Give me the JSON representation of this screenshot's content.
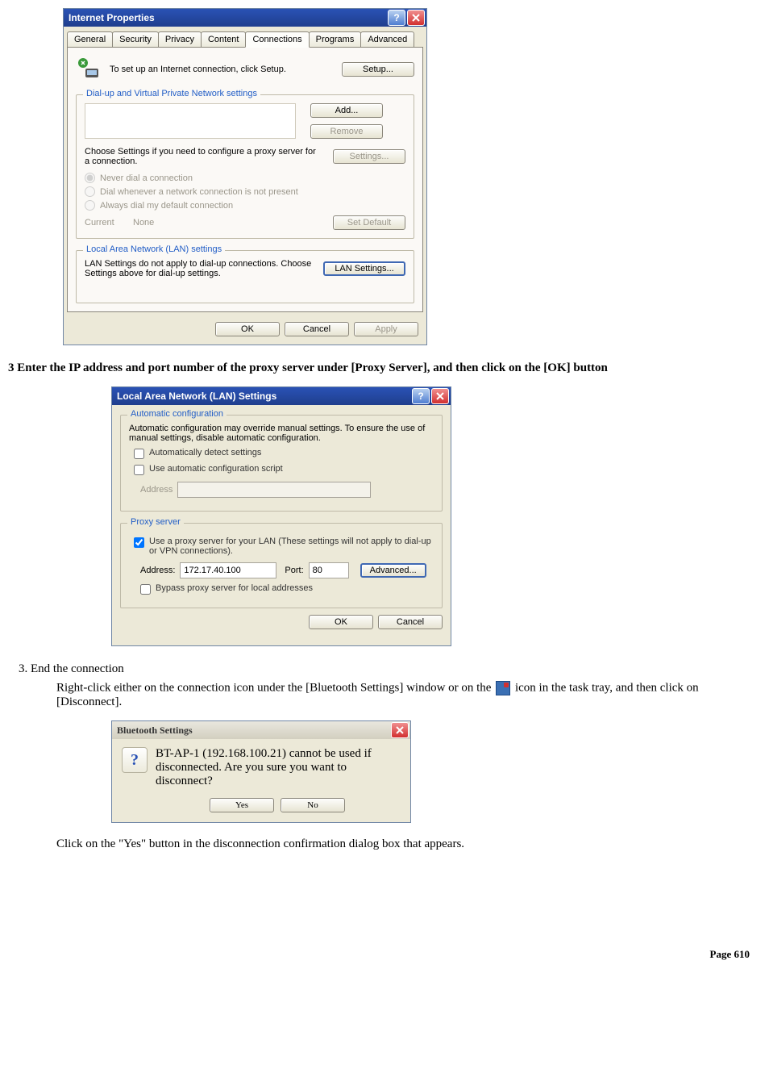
{
  "inetProps": {
    "title": "Internet Properties",
    "tabs": [
      "General",
      "Security",
      "Privacy",
      "Content",
      "Connections",
      "Programs",
      "Advanced"
    ],
    "activeTabIndex": 4,
    "setupLine": "To set up an Internet connection, click Setup.",
    "setupBtn": "Setup...",
    "dialGroup": {
      "legend": "Dial-up and Virtual Private Network settings",
      "addBtn": "Add...",
      "removeBtn": "Remove",
      "chooseText": "Choose Settings if you need to configure a proxy server for a connection.",
      "settingsBtn": "Settings...",
      "radios": [
        "Never dial a connection",
        "Dial whenever a network connection is not present",
        "Always dial my default connection"
      ],
      "currentLabel": "Current",
      "currentValue": "None",
      "setDefaultBtn": "Set Default"
    },
    "lanGroup": {
      "legend": "Local Area Network (LAN) settings",
      "text": "LAN Settings do not apply to dial-up connections. Choose Settings above for dial-up settings.",
      "lanBtn": "LAN Settings..."
    },
    "okBtn": "OK",
    "cancelBtn": "Cancel",
    "applyBtn": "Apply"
  },
  "instruction1": {
    "num": "3",
    "text": "Enter the IP address and port number of the proxy server under [Proxy Server], and then click on the [OK] button"
  },
  "lanDlg": {
    "title": "Local Area Network (LAN) Settings",
    "autoGroup": {
      "legend": "Automatic configuration",
      "desc": "Automatic configuration may override manual settings.  To ensure the use of manual settings, disable automatic configuration.",
      "chk1": "Automatically detect settings",
      "chk2": "Use automatic configuration script",
      "addressLabel": "Address"
    },
    "proxyGroup": {
      "legend": "Proxy server",
      "chk": "Use a proxy server for your LAN (These settings will not apply to dial-up or VPN connections).",
      "addressLabel": "Address:",
      "addressValue": "172.17.40.100",
      "portLabel": "Port:",
      "portValue": "80",
      "advancedBtn": "Advanced...",
      "bypassChk": "Bypass proxy server for local addresses"
    },
    "okBtn": "OK",
    "cancelBtn": "Cancel"
  },
  "step3": {
    "title": "End the connection",
    "para1a": "Right-click either on the connection icon under the [Bluetooth Settings] window or on the",
    "para1b": "icon in the task tray, and then click on [Disconnect].",
    "para2": "Click on the \"Yes\" button in the disconnection confirmation dialog box that appears."
  },
  "btDlg": {
    "title": "Bluetooth Settings",
    "msg": "BT-AP-1 (192.168.100.21) cannot be used if disconnected. Are you sure you want to disconnect?",
    "yesBtn": "Yes",
    "noBtn": "No"
  },
  "footer": {
    "pageLabel": "Page",
    "pageNum": "610"
  }
}
